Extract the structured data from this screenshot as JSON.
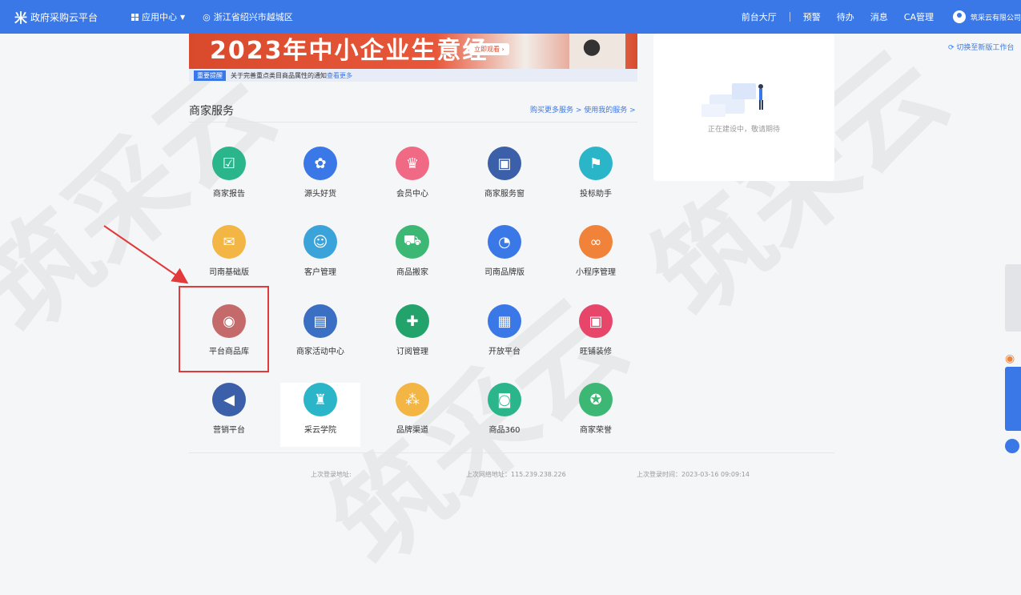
{
  "topbar": {
    "brand": "政府采购云平台",
    "brand_logo": "米",
    "app_center": "应用中心",
    "location": "浙江省绍兴市越城区",
    "links": [
      "前台大厅",
      "预警",
      "待办",
      "消息",
      "CA管理"
    ],
    "user": "筑采云有限公司"
  },
  "banner": {
    "title": "2023年中小企业生意经",
    "button": "立即观看 ›"
  },
  "notice": {
    "tag": "重要提醒",
    "text": "关于完善重点类目商品属性的通知",
    "more": "查看更多"
  },
  "section": {
    "title": "商家服务",
    "links": "购买更多服务 >  使用我的服务 >"
  },
  "tiles": [
    {
      "label": "商家报告",
      "color": "#2bb58a",
      "icon": "☑"
    },
    {
      "label": "源头好货",
      "color": "#3b78e7",
      "icon": "✿"
    },
    {
      "label": "会员中心",
      "color": "#f06a86",
      "icon": "♛"
    },
    {
      "label": "商家服务窗",
      "color": "#3b5fa8",
      "icon": "▣"
    },
    {
      "label": "投标助手",
      "color": "#2bb5c9",
      "icon": "⚑"
    },
    {
      "label": "司南基础版",
      "color": "#f3b544",
      "icon": "✉"
    },
    {
      "label": "客户管理",
      "color": "#3aa3d9",
      "icon": "☺"
    },
    {
      "label": "商品搬家",
      "color": "#3cb874",
      "icon": "⛟"
    },
    {
      "label": "司南品牌版",
      "color": "#3b78e7",
      "icon": "◔"
    },
    {
      "label": "小程序管理",
      "color": "#f0823a",
      "icon": "∞"
    },
    {
      "label": "平台商品库",
      "color": "#c46a6a",
      "icon": "◉"
    },
    {
      "label": "商家活动中心",
      "color": "#3a6fc4",
      "icon": "▤"
    },
    {
      "label": "订阅管理",
      "color": "#22a36b",
      "icon": "✚"
    },
    {
      "label": "开放平台",
      "color": "#3b78e7",
      "icon": "▦"
    },
    {
      "label": "旺铺装修",
      "color": "#e8456a",
      "icon": "▣"
    },
    {
      "label": "营销平台",
      "color": "#3b5fa8",
      "icon": "◀"
    },
    {
      "label": "采云学院",
      "color": "#2bb5c9",
      "icon": "♜"
    },
    {
      "label": "品牌渠道",
      "color": "#f3b544",
      "icon": "⁂"
    },
    {
      "label": "商品360",
      "color": "#2bb58a",
      "icon": "◙"
    },
    {
      "label": "商家荣誉",
      "color": "#3cb874",
      "icon": "✪"
    }
  ],
  "rightcard": {
    "message": "正在建设中，敬请期待"
  },
  "switch_label": "切换至新版工作台",
  "footer": {
    "last_login_addr": "上次登录地址:",
    "last_ip": "上次网络地址：115.239.238.226",
    "last_time": "上次登录时间：2023-03-16 09:09:14"
  },
  "watermark": "筑采云",
  "colors": {
    "primary": "#3b78e7",
    "highlight": "#e23a3a"
  }
}
